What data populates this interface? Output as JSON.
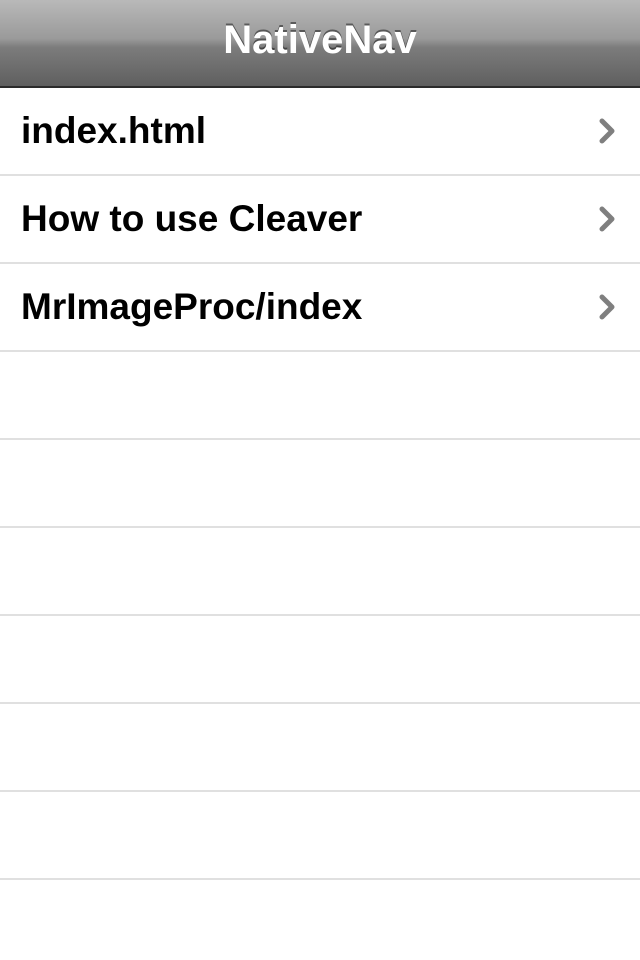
{
  "navbar": {
    "title": "NativeNav"
  },
  "table": {
    "rows": [
      {
        "label": "index.html",
        "accessory": "chevron-right-icon"
      },
      {
        "label": "How to use Cleaver",
        "accessory": "chevron-right-icon"
      },
      {
        "label": "MrImageProc/index",
        "accessory": "chevron-right-icon"
      }
    ]
  },
  "colors": {
    "separator": "#e0e0e0",
    "chevron": "#7f7f7f",
    "navbar_text": "#ffffff"
  }
}
